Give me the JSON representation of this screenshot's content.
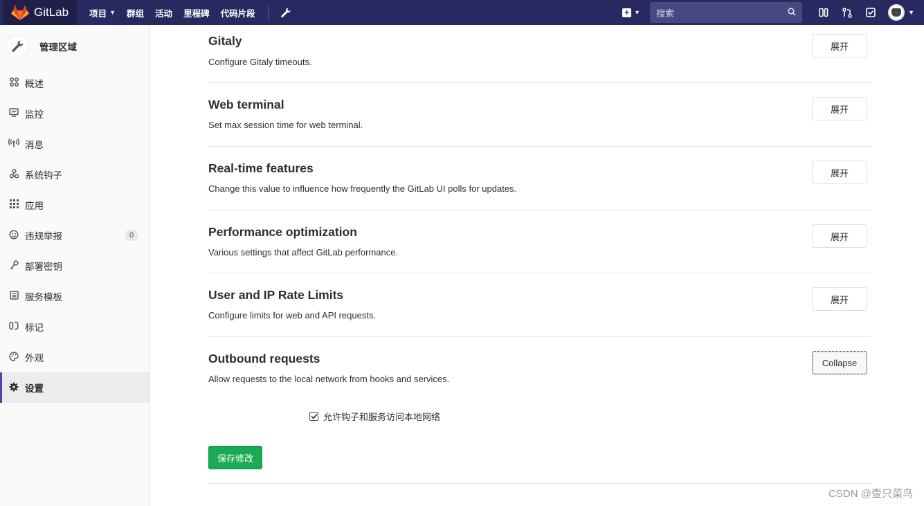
{
  "app": {
    "name": "GitLab"
  },
  "topnav": {
    "items": [
      {
        "label": "项目",
        "has_caret": true
      },
      {
        "label": "群组",
        "has_caret": false
      },
      {
        "label": "活动",
        "has_caret": false
      },
      {
        "label": "里程碑",
        "has_caret": false
      },
      {
        "label": "代码片段",
        "has_caret": false
      }
    ],
    "admin_icon": "wrench-icon",
    "search_placeholder": "搜索"
  },
  "sidebar": {
    "title": "管理区域",
    "items": [
      {
        "label": "概述",
        "icon": "overview-icon"
      },
      {
        "label": "监控",
        "icon": "monitor-icon"
      },
      {
        "label": "消息",
        "icon": "broadcast-icon"
      },
      {
        "label": "系统钩子",
        "icon": "hook-icon"
      },
      {
        "label": "应用",
        "icon": "apps-icon"
      },
      {
        "label": "违规举报",
        "icon": "smiley-icon",
        "badge": "0"
      },
      {
        "label": "部署密钥",
        "icon": "key-icon"
      },
      {
        "label": "服务模板",
        "icon": "template-icon"
      },
      {
        "label": "标记",
        "icon": "labels-icon"
      },
      {
        "label": "外观",
        "icon": "palette-icon"
      },
      {
        "label": "设置",
        "icon": "settings-icon",
        "active": true
      }
    ]
  },
  "sections": [
    {
      "title": "Gitaly",
      "description": "Configure Gitaly timeouts.",
      "button": "展开"
    },
    {
      "title": "Web terminal",
      "description": "Set max session time for web terminal.",
      "button": "展开"
    },
    {
      "title": "Real-time features",
      "description": "Change this value to influence how frequently the GitLab UI polls for updates.",
      "button": "展开"
    },
    {
      "title": "Performance optimization",
      "description": "Various settings that affect GitLab performance.",
      "button": "展开"
    },
    {
      "title": "User and IP Rate Limits",
      "description": "Configure limits for web and API requests.",
      "button": "展开"
    },
    {
      "title": "Outbound requests",
      "description": "Allow requests to the local network from hooks and services.",
      "button": "Collapse"
    }
  ],
  "outbound": {
    "checkbox_label": "允许钩子和服务访问本地网络",
    "checked": true,
    "save_label": "保存修改"
  },
  "watermark": "CSDN @壹只菜鸟"
}
